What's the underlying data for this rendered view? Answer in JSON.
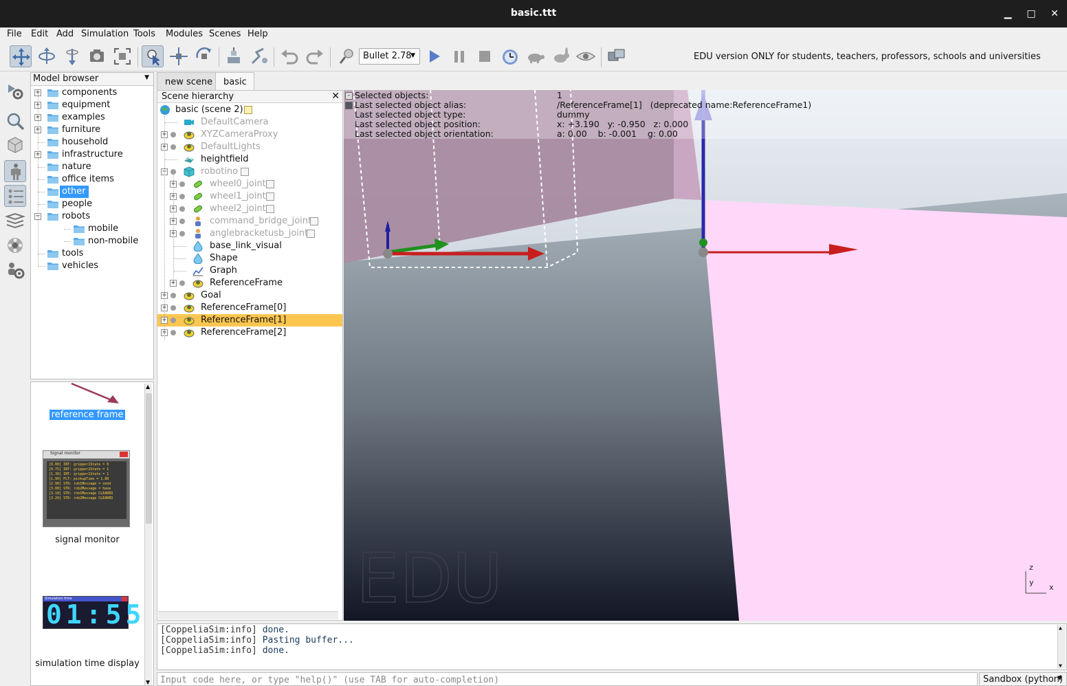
{
  "window": {
    "title": "basic.ttt",
    "minimize": "▁",
    "maximize": "□",
    "close": "✕"
  },
  "menu": [
    "File",
    "Edit",
    "Add",
    "Simulation",
    "Tools",
    "Modules",
    "Scenes",
    "Help"
  ],
  "toolbar": {
    "icons": [
      "camera-pan-icon",
      "camera-rotate-icon",
      "camera-shift-icon",
      "camera-angle-icon",
      "fit-to-view-icon",
      "click-select-icon",
      "object-shift-icon",
      "object-rotate-icon",
      "assemble-icon",
      "transfer-dna-icon",
      "undo-icon",
      "redo-icon",
      "dynamics-icon",
      "start-simulation-icon",
      "pause-simulation-icon",
      "stop-simulation-icon",
      "realtime-icon",
      "slower-icon",
      "faster-icon",
      "visualization-icon",
      "page-selector-icon"
    ],
    "engine": "Bullet 2.78",
    "edu_note": "EDU version ONLY for students, teachers, professors, schools and universities"
  },
  "vtoolbar": {
    "icons": [
      "simulation-settings-icon",
      "selection-icon",
      "model-browser-icon",
      "scene-hierarchy-icon",
      "layers-icon",
      "video-recorder-icon",
      "user-settings-icon"
    ]
  },
  "model_browser": {
    "title": "Model browser",
    "items": [
      {
        "label": "components",
        "expandable": true
      },
      {
        "label": "equipment",
        "expandable": true
      },
      {
        "label": "examples",
        "expandable": true
      },
      {
        "label": "furniture",
        "expandable": true
      },
      {
        "label": "household",
        "expandable": false
      },
      {
        "label": "infrastructure",
        "expandable": true
      },
      {
        "label": "nature",
        "expandable": false
      },
      {
        "label": "office items",
        "expandable": false
      },
      {
        "label": "other",
        "expandable": false,
        "selected": true
      },
      {
        "label": "people",
        "expandable": false
      },
      {
        "label": "robots",
        "expandable": true,
        "expanded": true
      },
      {
        "label": "mobile",
        "child": true
      },
      {
        "label": "non-mobile",
        "child": true
      },
      {
        "label": "tools",
        "expandable": false
      },
      {
        "label": "vehicles",
        "expandable": false
      }
    ]
  },
  "thumbnails": {
    "items": [
      "reference frame",
      "signal monitor",
      "simulation time display"
    ],
    "signal_monitor_title": "Signal monitor",
    "signal_monitor_lines": [
      "[0.00] INT: gripper1State = 0",
      "[0.75] INT: gripper2State = 1",
      "[1.30] INT: gripper1State = 1",
      "[1.90] FLT: pickupTime = 1.80",
      "[2.90] STR: rob1Message = send",
      "[3.00] STR: rob2Message = have",
      "[3.10] STR: rob1Message CLEARED",
      "[3.20] STR: rob2Message CLEARED"
    ],
    "time_display_title": "Simulation time",
    "time_display_value": "01:55"
  },
  "tabs": [
    "new scene",
    "basic"
  ],
  "hierarchy": {
    "title": "Scene hierarchy",
    "close": "✕",
    "scene": "basic (scene 2)",
    "rows": [
      {
        "label": "DefaultCamera",
        "icon": "camera-icon",
        "dim": true
      },
      {
        "label": "XYZCameraProxy",
        "icon": "dummy-icon",
        "dim": true
      },
      {
        "label": "DefaultLights",
        "icon": "dummy-icon",
        "dim": true
      },
      {
        "label": "heightfield",
        "icon": "heightfield-icon"
      },
      {
        "label": "robotino",
        "icon": "cube-icon",
        "dim": true
      },
      {
        "label": "wheel0_joint",
        "icon": "joint-icon",
        "dim": true
      },
      {
        "label": "wheel1_joint",
        "icon": "joint-icon",
        "dim": true
      },
      {
        "label": "wheel2_joint",
        "icon": "joint-icon",
        "dim": true
      },
      {
        "label": "command_bridge_joint",
        "icon": "user-icon",
        "dim": true
      },
      {
        "label": "anglebracketusb_joint",
        "icon": "user-icon",
        "dim": true
      },
      {
        "label": "base_link_visual",
        "icon": "shape-icon"
      },
      {
        "label": "Shape",
        "icon": "shape-icon"
      },
      {
        "label": "Graph",
        "icon": "graph-icon"
      },
      {
        "label": "ReferenceFrame",
        "icon": "dummy-icon"
      },
      {
        "label": "Goal",
        "icon": "dummy-icon"
      },
      {
        "label": "ReferenceFrame[0]",
        "icon": "dummy-icon"
      },
      {
        "label": "ReferenceFrame[1]",
        "icon": "dummy-icon",
        "selected": true
      },
      {
        "label": "ReferenceFrame[2]",
        "icon": "dummy-icon"
      }
    ]
  },
  "viewport": {
    "info": [
      {
        "key": "Selected objects:",
        "value": "1"
      },
      {
        "key": "Last selected object alias:",
        "value": "/ReferenceFrame[1]   (deprecated name:ReferenceFrame1)"
      },
      {
        "key": "Last selected object type:",
        "value": "dummy"
      },
      {
        "key": "Last selected object position:",
        "value": "x: +3.190   y: -0.950   z: 0.000"
      },
      {
        "key": "Last selected object orientation:",
        "value": "a: 0.00    b: -0.001    g: 0.00"
      }
    ],
    "watermark": "EDU",
    "axes": {
      "z": "z",
      "y": "y",
      "x": "x"
    }
  },
  "console": {
    "lines": [
      {
        "tag": "[CoppeliaSim:info]",
        "msg": "done."
      },
      {
        "tag": "[CoppeliaSim:info]",
        "msg": "Pasting buffer..."
      },
      {
        "tag": "[CoppeliaSim:info]",
        "msg": "done."
      }
    ],
    "input_placeholder": "Input code here, or type \"help()\" (use TAB for auto-completion)",
    "sandbox": "Sandbox (python)"
  },
  "colors": {
    "selection": "#3399ff",
    "hier_selected": "#fcc650",
    "floor_pink": "#ffd7f9"
  }
}
